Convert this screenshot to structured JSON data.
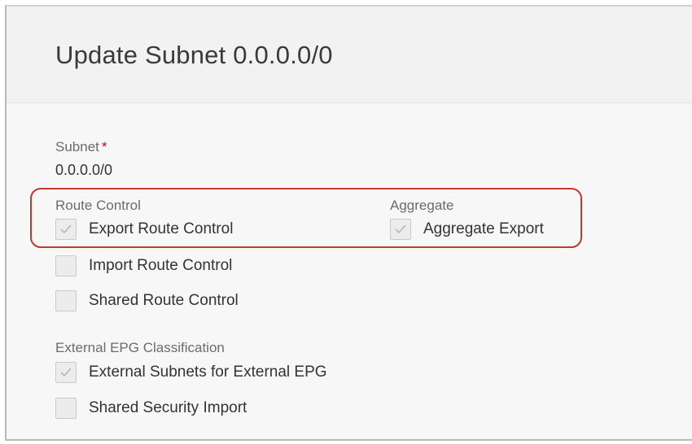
{
  "dialog": {
    "title": "Update Subnet 0.0.0.0/0"
  },
  "subnet": {
    "label": "Subnet",
    "required_mark": "*",
    "value": "0.0.0.0/0"
  },
  "route_control": {
    "label": "Route Control",
    "options": [
      {
        "label": "Export Route Control",
        "checked": true
      },
      {
        "label": "Import Route Control",
        "checked": false
      },
      {
        "label": "Shared Route Control",
        "checked": false
      }
    ]
  },
  "aggregate": {
    "label": "Aggregate",
    "options": [
      {
        "label": "Aggregate Export",
        "checked": true
      }
    ]
  },
  "external_epg": {
    "label": "External EPG Classification",
    "options": [
      {
        "label": "External Subnets for External EPG",
        "checked": true
      },
      {
        "label": "Shared Security Import",
        "checked": false
      }
    ]
  },
  "colors": {
    "highlight": "#c0392b",
    "required": "#d0021b",
    "checkmark": "#b5b5b5"
  }
}
